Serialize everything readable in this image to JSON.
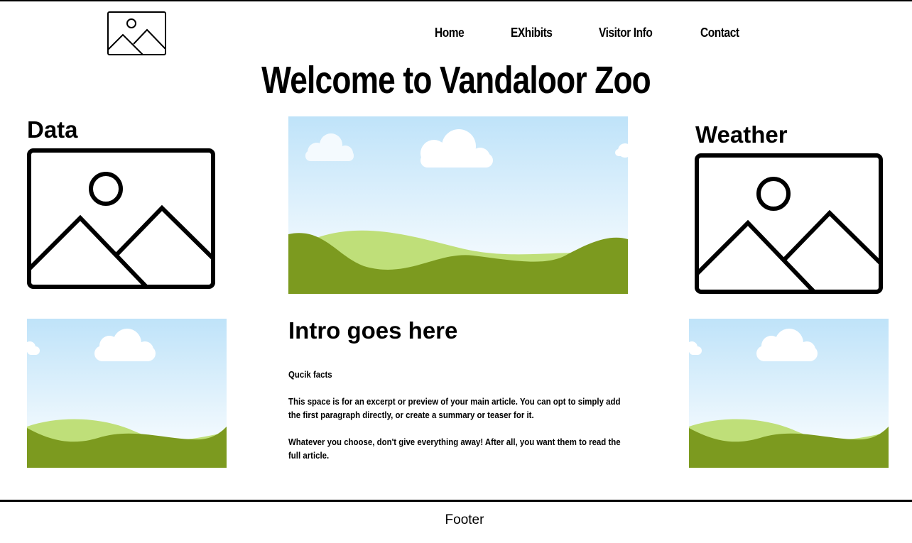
{
  "header": {
    "logo_icon": "image-placeholder-icon",
    "nav": [
      {
        "label": "Home"
      },
      {
        "label": "EXhibits"
      },
      {
        "label": "Visitor Info"
      },
      {
        "label": "Contact"
      }
    ]
  },
  "main": {
    "title": "Welcome to Vandaloor Zoo",
    "data_section": {
      "heading": "Data",
      "icon": "image-placeholder-icon"
    },
    "weather_section": {
      "heading": "Weather",
      "icon": "image-placeholder-icon"
    },
    "hero_image": "landscape-illustration",
    "intro": {
      "heading": "Intro goes here",
      "quick_facts": "Qucik facts",
      "paragraph_1": "This space is for an excerpt or preview of your main article. You can opt to simply add the first paragraph directly, or create a summary or teaser for it.",
      "paragraph_2": "Whatever you choose, don't give everything away! After all, you want them to read the full article."
    }
  },
  "footer": {
    "text": "Footer"
  },
  "colors": {
    "sky_top": "#bfe3f9",
    "sky_bottom": "#ffffff",
    "hill_dark": "#7c9a1f",
    "hill_light": "#bfdf79",
    "cloud": "#ffffff"
  }
}
